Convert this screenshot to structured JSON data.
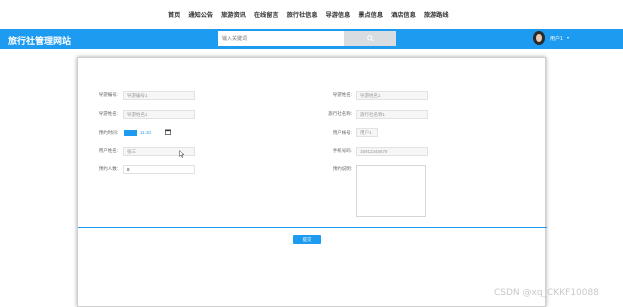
{
  "top_nav": {
    "items": [
      "首页",
      "通知公告",
      "旅游资讯",
      "在线留言",
      "旅行社信息",
      "导游信息",
      "景点信息",
      "酒店信息",
      "旅游路线"
    ]
  },
  "header": {
    "site_title": "旅行社管理网站",
    "search_placeholder": "输入关键词",
    "user_name": "用户1",
    "caret": "▾",
    "accent_color": "#1d9bf0"
  },
  "form": {
    "fields": {
      "guide_no": {
        "label": "导游编号:",
        "value": "导游编号1"
      },
      "guide_name": {
        "label": "导游姓名:",
        "value": "导游姓名1"
      },
      "agency_name": {
        "label": "旅行社名称:",
        "value": "旅行社名称1"
      },
      "book_time": {
        "label": "预约时间:",
        "date_text": "11:10"
      },
      "user_account": {
        "label": "用户帐号:",
        "value": "用户1"
      },
      "user_name": {
        "label": "用户姓名:",
        "value": "张三"
      },
      "phone": {
        "label": "手机号码:",
        "value": "16912345678"
      },
      "people_count": {
        "label": "预约人数:",
        "value": "8"
      },
      "remark": {
        "label": "预约说明:"
      }
    },
    "submit_label": "提交"
  },
  "watermark": "CSDN @xq_CKKF10088"
}
